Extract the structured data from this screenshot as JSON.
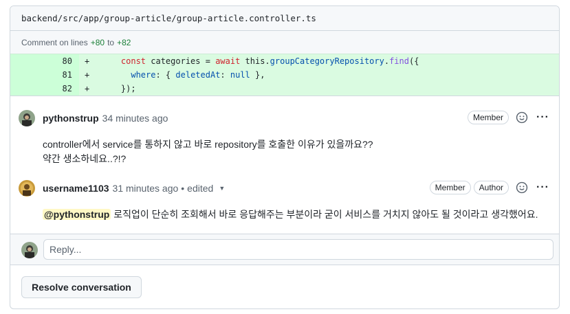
{
  "file": {
    "path": "backend/src/app/group-article/group-article.controller.ts"
  },
  "comment_range": {
    "prefix": "Comment on lines",
    "start": "+80",
    "sep": "to",
    "end": "+82"
  },
  "diff": {
    "lines": [
      {
        "num": "80",
        "sign": "+"
      },
      {
        "num": "81",
        "sign": "+"
      },
      {
        "num": "82",
        "sign": "+"
      }
    ],
    "code": {
      "l80": {
        "indent": "    ",
        "kw_const": "const",
        "t1": " categories = ",
        "kw_await": "await",
        "t2": " this.",
        "repo": "groupCategoryRepository",
        "t3": ".",
        "fn": "find",
        "t4": "({"
      },
      "l81": {
        "indent": "      ",
        "prop": "where",
        "t1": ": { ",
        "key": "deletedAt",
        "t2": ": ",
        "val": "null",
        "t3": " },"
      },
      "l82": {
        "indent": "    ",
        "t1": "});"
      }
    }
  },
  "comments": [
    {
      "author": "pythonstrup",
      "time": "34 minutes ago",
      "badges": [
        "Member"
      ],
      "body_line1": "controller에서 service를 통하지 않고 바로 repository를 호출한 이유가 있을까요??",
      "body_line2": "약간 생소하네요..?!?"
    },
    {
      "author": "username1103",
      "time": "31 minutes ago",
      "dot": "•",
      "edited": "edited",
      "badges": [
        "Member",
        "Author"
      ],
      "mention": "@pythonstrup",
      "body": " 로직업이 단순히 조회해서 바로 응답해주는 부분이라 굳이 서비스를 거치지 않아도 될 것이라고 생각했어요."
    }
  ],
  "reply": {
    "placeholder": "Reply..."
  },
  "actions": {
    "resolve_label": "Resolve conversation",
    "more": "···"
  },
  "colors": {
    "added_bg": "#dafbe1",
    "added_num_bg": "#ccffd8",
    "keyword": "#cf222e",
    "function": "#8250df",
    "property": "#0550ae",
    "mention_bg": "#fff8c5"
  },
  "icons": [
    "smiley-icon",
    "kebab-horizontal-icon",
    "triangle-down-icon",
    "avatar"
  ]
}
